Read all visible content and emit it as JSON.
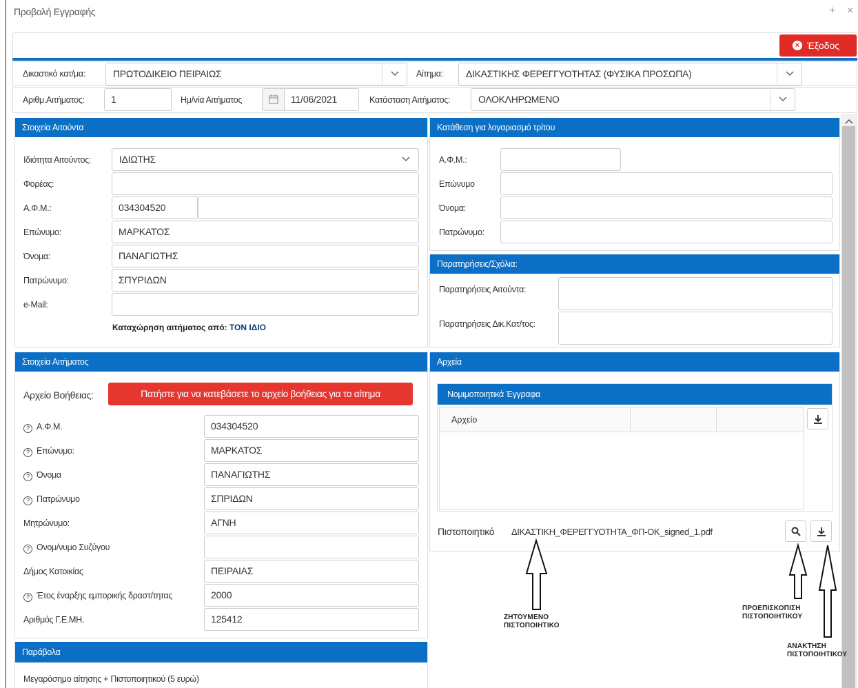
{
  "window": {
    "title": "Προβολή Εγγραφής",
    "plus_icon": "+",
    "close_icon": "×"
  },
  "toolbar": {
    "exit_label": "Έξοδος"
  },
  "header": {
    "court_label": "Δικαστικό κατ/μα:",
    "court_value": "ΠΡΩΤΟΔΙΚΕΙΟ ΠΕΙΡΑΙΩΣ",
    "request_label": "Αίτημα:",
    "request_value": "ΔΙΚΑΣΤΙΚΗΣ ΦΕΡΕΓΓΥΟΤΗΤΑΣ (ΦΥΣΙΚΑ ΠΡΟΣΩΠΑ)",
    "reqno_label": "Αριθμ.Αιτήματος:",
    "reqno_value": "1",
    "date_label": "Ημ/νία Αιτήματος",
    "date_value": "11/06/2021",
    "status_label": "Κατάσταση Αιτήματος:",
    "status_value": "ΟΛΟΚΛΗΡΩΜΕΝΟ"
  },
  "applicant": {
    "title": "Στοιχεία Αιτούντα",
    "capacity_label": "Ιδιότητα Αιτούντος:",
    "capacity_value": "ΙΔΙΩΤΗΣ",
    "body_label": "Φορέας:",
    "body_value": "",
    "afm_label": "Α.Φ.Μ.:",
    "afm_value": "034304520",
    "afm_extra": "",
    "surname_label": "Επώνυμο:",
    "surname_value": "ΜΑΡΚΑΤΟΣ",
    "name_label": "Όνομα:",
    "name_value": "ΠΑΝΑΓΙΩΤΗΣ",
    "father_label": "Πατρώνυμο:",
    "father_value": "ΣΠΥΡΙΔΩΝ",
    "email_label": "e-Mail:",
    "email_value": "",
    "registered_by_label": "Καταχώρηση αιτήματος από:",
    "registered_by_value": "ΤΟΝ ΙΔΙΟ"
  },
  "third_party": {
    "title": "Κατάθεση για λογαριασμό τρίτου",
    "afm_label": "Α.Φ.Μ.:",
    "afm_value": "",
    "surname_label": "Επώνυμο",
    "surname_value": "",
    "name_label": "Όνομα:",
    "name_value": "",
    "father_label": "Πατρώνυμο:",
    "father_value": ""
  },
  "remarks": {
    "title": "Παρατηρήσεις/Σχόλια:",
    "applicant_label": "Παρατηρήσεις Αιτούντα:",
    "applicant_value": "",
    "court_label": "Παρατηρήσεις Δικ.Κατ/τος:",
    "court_value": ""
  },
  "request_details": {
    "title": "Στοιχεία Αιτήματος",
    "help_label": "Αρχείο Βοήθειας:",
    "help_button": "Πατήστε για να κατεβάσετε το αρχείο βοήθειας για το αίτημα",
    "fields": [
      {
        "label": "Α.Φ.Μ.",
        "value": "034304520",
        "help": true
      },
      {
        "label": "Επώνυμο:",
        "value": "ΜΑΡΚΑΤΟΣ",
        "help": true
      },
      {
        "label": "Όνομα",
        "value": "ΠΑΝΑΓΙΩΤΗΣ",
        "help": true
      },
      {
        "label": "Πατρώνυμο",
        "value": "ΣΠΡΙΔΩΝ",
        "help": true
      },
      {
        "label": "Μητρώνυμο:",
        "value": "ΑΓΝΗ",
        "help": false
      },
      {
        "label": "Ονομ/νυμο Συζύγου",
        "value": "",
        "help": true
      },
      {
        "label": "Δήμος Κατοικίας",
        "value": "ΠΕΙΡΑΙΑΣ",
        "help": false
      },
      {
        "label": "Έτος έναρξης εμπορικής δραστ/τητας",
        "value": "2000",
        "help": true
      },
      {
        "label": "Αριθμός Γ.Ε.ΜΗ.",
        "value": "125412",
        "help": false
      }
    ]
  },
  "files": {
    "title": "Αρχεία",
    "docs_title": "Νομιμοποιητικά Έγγραφα",
    "col_file": "Αρχείο",
    "certificate_label": "Πιστοποιητικό",
    "certificate_file": "ΔΙΚΑΣΤΙΚΗ_ΦΕΡΕΓΓΥΟΤΗΤΑ_ΦΠ-OK_signed_1.pdf"
  },
  "fee": {
    "title": "Παράβολα",
    "line": "Μεγαρόσημο αίτησης + Πιστοποιητικού (5 ευρώ)"
  },
  "annotations": {
    "requested": "ΖΗΤΟΥΜΕΝΟ ΠΙΣΤΟΠΟΙΗΤΙΚΟ",
    "preview": "ΠΡΟΕΠΙΣΚΟΠΙΣΗ ΠΙΣΤΟΠΟΙΗΤΙΚΟΥ",
    "download": "ΑΝΑΚΤΗΣΗ ΠΙΣΤΟΠΟΙΗΤΙΚΟΥ"
  },
  "colors": {
    "header_blue": "#0a6fc5",
    "exit_red": "#e02b26",
    "help_red": "#e53630"
  }
}
